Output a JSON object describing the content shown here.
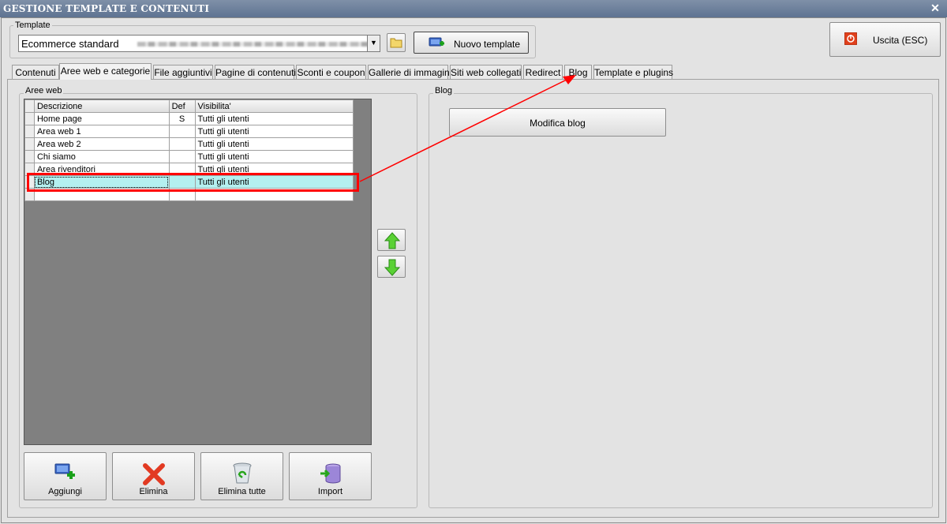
{
  "window": {
    "title": "GESTIONE TEMPLATE E CONTENUTI"
  },
  "template_group": {
    "label": "Template",
    "selected": "Ecommerce standard",
    "new_template_label": "Nuovo template"
  },
  "exit_button": {
    "label": "Uscita (ESC)"
  },
  "tabs": [
    {
      "label": "Contenuti"
    },
    {
      "label": "Aree web e categorie"
    },
    {
      "label": "File aggiuntivi"
    },
    {
      "label": "Pagine di contenuti"
    },
    {
      "label": "Sconti e coupon"
    },
    {
      "label": "Gallerie di immagini"
    },
    {
      "label": "Siti web collegati"
    },
    {
      "label": "Redirect"
    },
    {
      "label": "Blog"
    },
    {
      "label": "Template e plugins"
    }
  ],
  "aree_web": {
    "label": "Aree web",
    "columns": {
      "descrizione": "Descrizione",
      "def": "Def",
      "visibilita": "Visibilita'"
    },
    "rows": [
      {
        "descrizione": "Home page",
        "def": "S",
        "visibilita": "Tutti gli utenti"
      },
      {
        "descrizione": "Area web 1",
        "def": "",
        "visibilita": "Tutti gli utenti"
      },
      {
        "descrizione": "Area web 2",
        "def": "",
        "visibilita": "Tutti gli utenti"
      },
      {
        "descrizione": "Chi siamo",
        "def": "",
        "visibilita": "Tutti gli utenti"
      },
      {
        "descrizione": "Area rivenditori",
        "def": "",
        "visibilita": "Tutti gli utenti"
      },
      {
        "descrizione": "Blog",
        "def": "",
        "visibilita": "Tutti gli utenti"
      }
    ],
    "buttons": {
      "add": "Aggiungi",
      "delete": "Elimina",
      "delete_all": "Elimina tutte",
      "import": "Import"
    }
  },
  "blog_group": {
    "label": "Blog",
    "edit_button": "Modifica blog"
  },
  "colors": {
    "selection": "#b4f0f0",
    "highlight": "#ff0000",
    "titlebar": "#6b7f9b"
  }
}
